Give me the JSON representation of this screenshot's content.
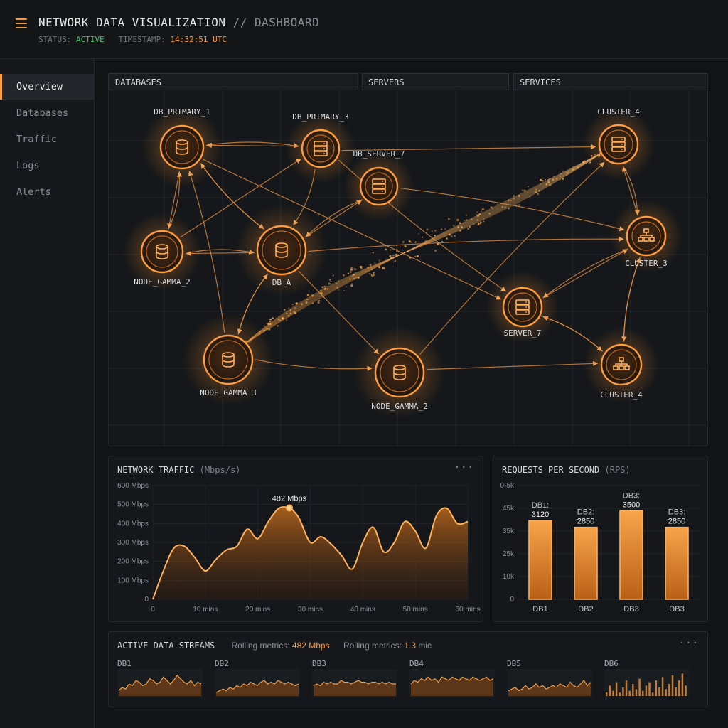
{
  "header": {
    "title": "NETWORK DATA VISUALIZATION",
    "separator": "//",
    "subtitle": "DASHBOARD",
    "status_label": "STATUS:",
    "status_value": "ACTIVE",
    "timestamp_label": "TIMESTAMP:",
    "timestamp_value": "14:32:51 UTC"
  },
  "sidebar": {
    "items": [
      {
        "label": "Overview",
        "active": true
      },
      {
        "label": "Databases",
        "active": false
      },
      {
        "label": "Traffic",
        "active": false
      },
      {
        "label": "Logs",
        "active": false
      },
      {
        "label": "Alerts",
        "active": false
      }
    ]
  },
  "network": {
    "tabs": [
      "DATABASES",
      "SERVERS",
      "SERVICES"
    ],
    "nodes": [
      {
        "label": "DB_PRIMARY_1",
        "icon": "database-icon"
      },
      {
        "label": "DB_PRIMARY_3",
        "icon": "server-icon"
      },
      {
        "label": "DB_SERVER_7",
        "icon": "server-icon"
      },
      {
        "label": "CLUSTER_4",
        "icon": "server-icon"
      },
      {
        "label": "NODE_GAMMA_2",
        "icon": "database-icon"
      },
      {
        "label": "DB_A",
        "icon": "database-icon"
      },
      {
        "label": "CLUSTER_3",
        "icon": "hierarchy-icon"
      },
      {
        "label": "SERVER_7",
        "icon": "server-icon"
      },
      {
        "label": "NODE_GAMMA_3",
        "icon": "database-icon"
      },
      {
        "label": "NODE_GAMMA_2",
        "icon": "database-icon"
      },
      {
        "label": "CLUSTER_4",
        "icon": "hierarchy-icon"
      }
    ]
  },
  "traffic": {
    "title": "NETWORK TRAFFIC",
    "unit": "(Mbps/s)",
    "menu": "···",
    "peak_label": "482 Mbps",
    "y_ticks": [
      "0",
      "100 Mbps",
      "200 Mbps",
      "300 Mbps",
      "400 Mbps",
      "500 Mbps",
      "600 Mbps"
    ],
    "x_ticks": [
      "0",
      "10 mins",
      "20 mins",
      "30 mins",
      "40 mins",
      "50 mins",
      "60 mins"
    ]
  },
  "rps": {
    "title": "REQUESTS PER SECOND",
    "unit": "(RPS)",
    "y_ticks": [
      "0",
      "10k",
      "25k",
      "35k",
      "45k",
      "0-5k"
    ],
    "bars": [
      {
        "label": "DB1",
        "top_label": "DB1:",
        "value_label": "3120"
      },
      {
        "label": "DB2",
        "top_label": "DB2:",
        "value_label": "2850"
      },
      {
        "label": "DB3",
        "top_label": "DB3:",
        "value_label": "3500"
      },
      {
        "label": "DB3",
        "top_label": "DB3:",
        "value_label": "2850"
      }
    ]
  },
  "streams": {
    "title": "ACTIVE DATA STREAMS",
    "metric1_label": "Rolling metrics:",
    "metric1_value": "482 Mbps",
    "metric2_label": "Rolling metrics:",
    "metric2_value": "1.3",
    "metric2_unit": "mic",
    "menu": "···",
    "items": [
      "DB1",
      "DB2",
      "DB3",
      "DB4",
      "DB5",
      "DB6"
    ]
  },
  "chart_data": [
    {
      "type": "area",
      "title": "NETWORK TRAFFIC (Mbps/s)",
      "xlabel": "",
      "ylabel": "",
      "x_unit": "mins",
      "ylim": [
        0,
        600
      ],
      "xlim": [
        0,
        60
      ],
      "grid": true,
      "x": [
        0,
        2,
        4,
        6,
        8,
        10,
        12,
        14,
        16,
        18,
        20,
        22,
        24,
        26,
        27,
        28,
        30,
        32,
        34,
        36,
        38,
        40,
        42,
        44,
        46,
        48,
        50,
        52,
        54,
        56,
        58,
        60
      ],
      "values": [
        0,
        150,
        270,
        280,
        220,
        150,
        210,
        260,
        280,
        370,
        320,
        410,
        480,
        482,
        460,
        420,
        300,
        330,
        290,
        230,
        160,
        300,
        380,
        250,
        300,
        410,
        360,
        270,
        440,
        480,
        400,
        410
      ]
    },
    {
      "type": "bar",
      "title": "REQUESTS PER SECOND (RPS)",
      "categories": [
        "DB1",
        "DB2",
        "DB3",
        "DB3"
      ],
      "values": [
        3120,
        2850,
        3500,
        2850
      ],
      "ylim": [
        0,
        4500
      ],
      "grid": true
    },
    {
      "type": "line",
      "title": "ACTIVE DATA STREAMS",
      "series": [
        {
          "name": "DB1",
          "values": [
            3,
            5,
            4,
            7,
            6,
            9,
            8,
            6,
            7,
            10,
            9,
            7,
            8,
            11,
            9,
            7,
            9,
            12,
            10,
            8,
            7,
            9,
            6,
            8,
            7
          ]
        },
        {
          "name": "DB2",
          "values": [
            2,
            3,
            4,
            3,
            5,
            4,
            6,
            5,
            7,
            6,
            8,
            7,
            6,
            8,
            9,
            7,
            8,
            7,
            9,
            8,
            7,
            8,
            7,
            6,
            7
          ]
        },
        {
          "name": "DB3",
          "values": [
            6,
            7,
            6,
            8,
            7,
            8,
            7,
            7,
            9,
            8,
            8,
            7,
            8,
            9,
            8,
            8,
            7,
            8,
            8,
            7,
            8,
            7,
            8,
            7,
            7
          ]
        },
        {
          "name": "DB4",
          "values": [
            7,
            9,
            8,
            10,
            9,
            11,
            9,
            10,
            8,
            11,
            10,
            9,
            11,
            10,
            9,
            11,
            10,
            9,
            11,
            10,
            9,
            10,
            11,
            9,
            10
          ]
        },
        {
          "name": "DB5",
          "values": [
            3,
            4,
            5,
            3,
            4,
            6,
            4,
            5,
            7,
            5,
            6,
            4,
            5,
            6,
            5,
            7,
            6,
            5,
            8,
            6,
            5,
            7,
            9,
            6,
            8
          ]
        },
        {
          "name": "DB6",
          "values": [
            2,
            6,
            3,
            8,
            2,
            5,
            9,
            3,
            7,
            4,
            10,
            3,
            6,
            8,
            2,
            9,
            5,
            11,
            4,
            7,
            12,
            5,
            9,
            13,
            6
          ]
        }
      ]
    }
  ],
  "colors": {
    "accent": "#f59a3a",
    "status_active": "#43c26b",
    "background": "#111315",
    "panel": "#15171a"
  }
}
